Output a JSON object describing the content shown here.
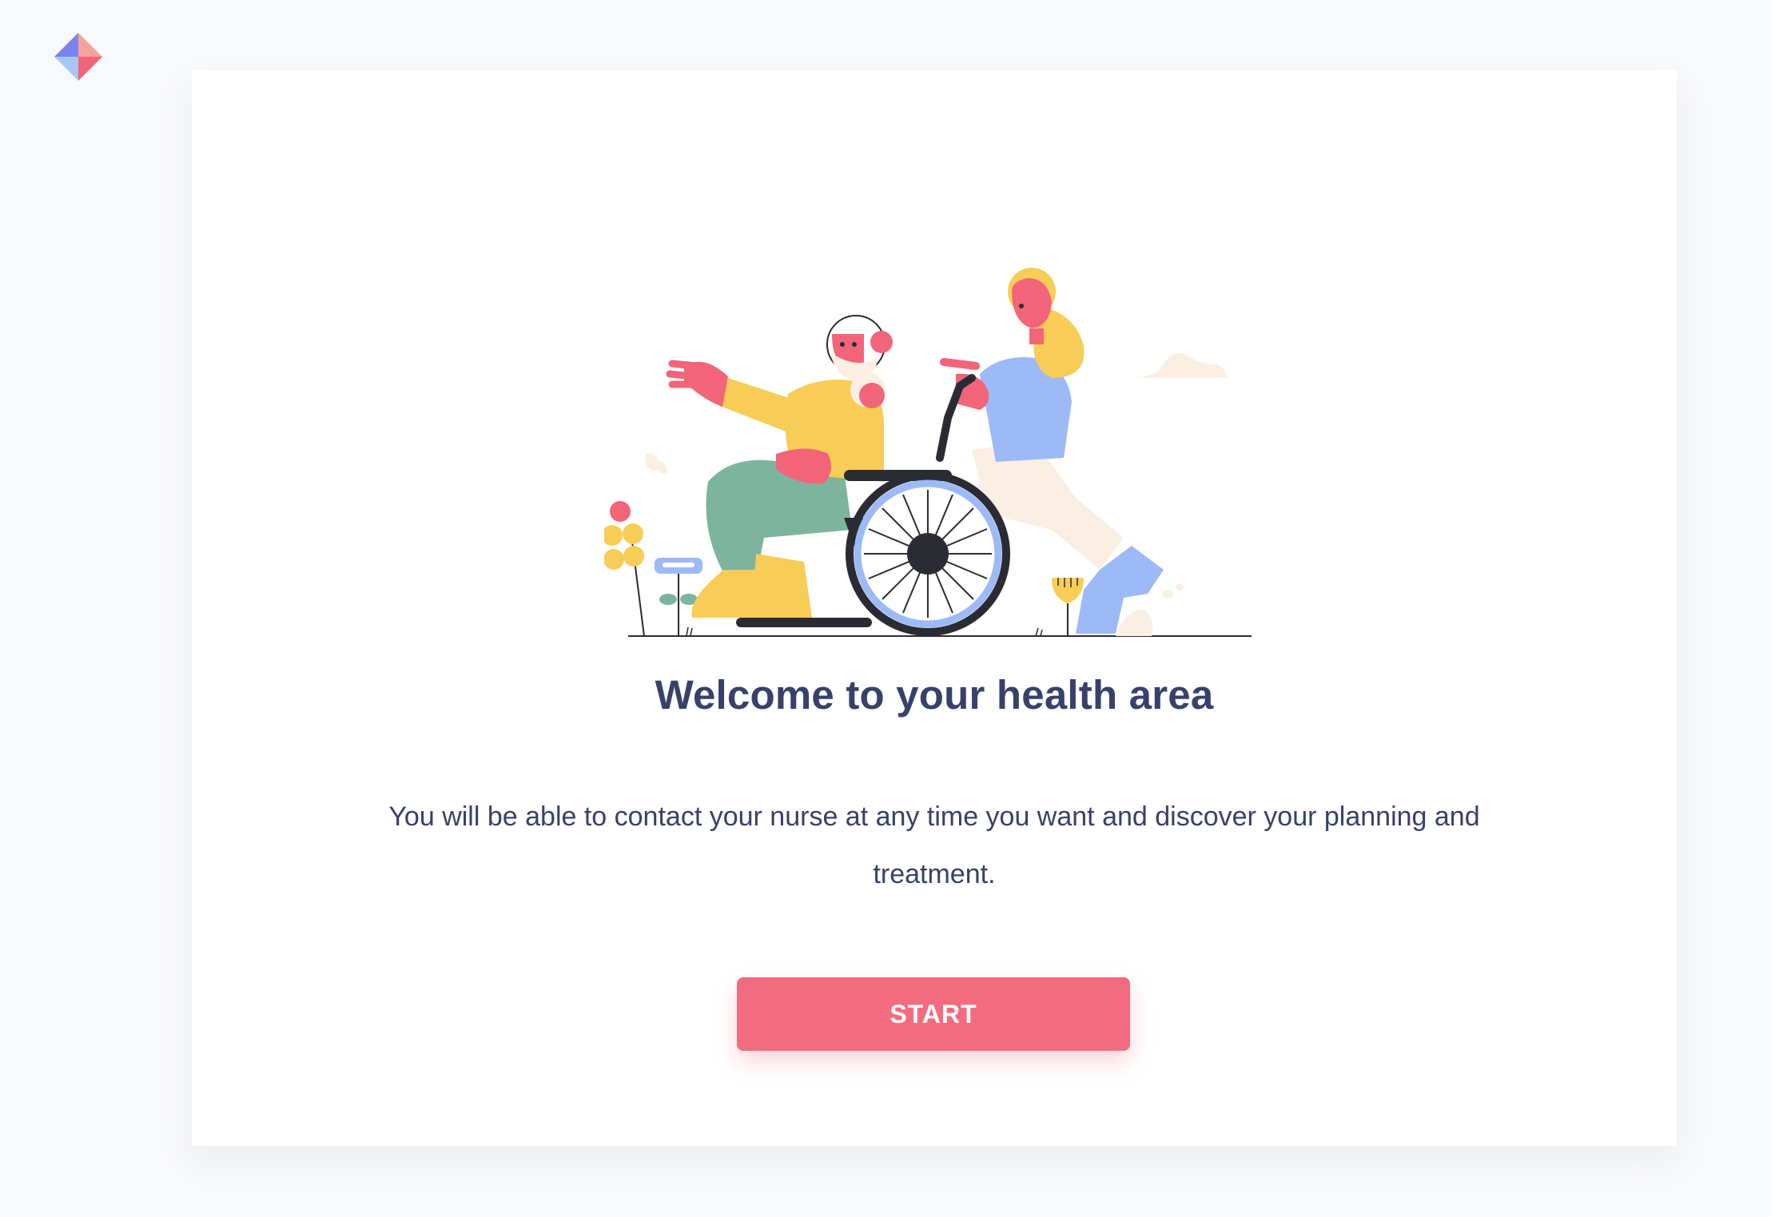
{
  "logo": {
    "icon": "app-logo-icon"
  },
  "welcome": {
    "illustration": "nurse-pushing-wheelchair-illustration",
    "title": "Welcome to your health area",
    "description": "You will be able to contact your nurse at any time you want and discover your planning and treatment.",
    "start_label": "START"
  },
  "colors": {
    "accent": "#f36b7f",
    "text": "#37416a",
    "background": "#f8f9fb",
    "card": "#ffffff"
  }
}
